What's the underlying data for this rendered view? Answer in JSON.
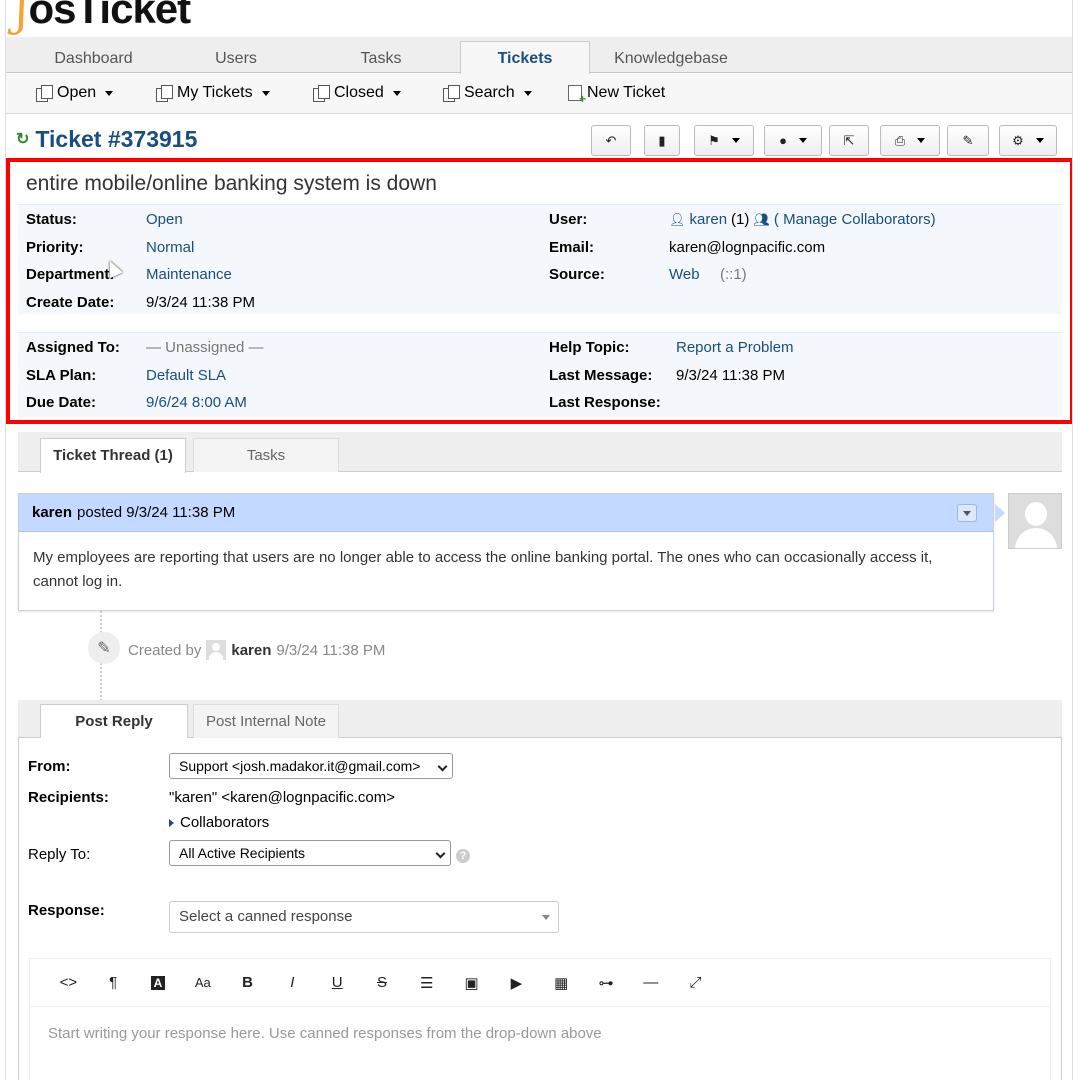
{
  "logo": {
    "mark": "ʃ",
    "word": "osTicket"
  },
  "nav": {
    "tabs": [
      {
        "label": "Dashboard"
      },
      {
        "label": "Users"
      },
      {
        "label": "Tasks"
      },
      {
        "label": "Tickets"
      },
      {
        "label": "Knowledgebase"
      }
    ],
    "active": "Tickets"
  },
  "subnav": {
    "open": "Open",
    "my_tickets": "My Tickets",
    "closed": "Closed",
    "search": "Search",
    "new_ticket": "New Ticket"
  },
  "ticket": {
    "number": "Ticket #373915",
    "subject": "entire mobile/online banking system is down",
    "labels": {
      "status": "Status:",
      "priority": "Priority:",
      "department": "Department:",
      "create_date": "Create Date:",
      "user": "User:",
      "email": "Email:",
      "source": "Source:",
      "assigned_to": "Assigned To:",
      "sla_plan": "SLA Plan:",
      "due_date": "Due Date:",
      "help_topic": "Help Topic:",
      "last_message": "Last Message:",
      "last_response": "Last Response:"
    },
    "status": "Open",
    "priority": "Normal",
    "department": "Maintenance",
    "create_date": "9/3/24 11:38 PM",
    "user_name": "karen",
    "user_count": "(1)",
    "manage_collaborators": "( Manage Collaborators)",
    "email": "karen@lognpacific.com",
    "source": "Web",
    "source_ip": "(::1)",
    "assigned_to": "— Unassigned —",
    "sla_plan": "Default SLA",
    "due_date": "9/6/24 8:00 AM",
    "help_topic": "Report a Problem",
    "last_message": "9/3/24 11:38 PM",
    "last_response": ""
  },
  "thread_tabs": {
    "thread": "Ticket Thread (1)",
    "tasks": "Tasks"
  },
  "entry": {
    "author": "karen",
    "posted": "posted 9/3/24 11:38 PM",
    "body": "My employees are reporting that users are no longer able to access the online banking portal. The ones who can occasionally access it, cannot log in."
  },
  "event": {
    "created_by": "Created by",
    "user": "karen",
    "time": "9/3/24 11:38 PM"
  },
  "reply": {
    "tabs": {
      "post_reply": "Post Reply",
      "internal_note": "Post Internal Note"
    },
    "from_label": "From:",
    "from_value": "Support <josh.madakor.it@gmail.com>",
    "recipients_label": "Recipients:",
    "recipients_value": "\"karen\" <karen@lognpacific.com>",
    "collaborators": "Collaborators",
    "reply_to_label": "Reply To:",
    "reply_to_value": "All Active Recipients",
    "response_label": "Response:",
    "canned_placeholder": "Select a canned response",
    "editor_placeholder": "Start writing your response here. Use canned responses from the drop-down above"
  }
}
